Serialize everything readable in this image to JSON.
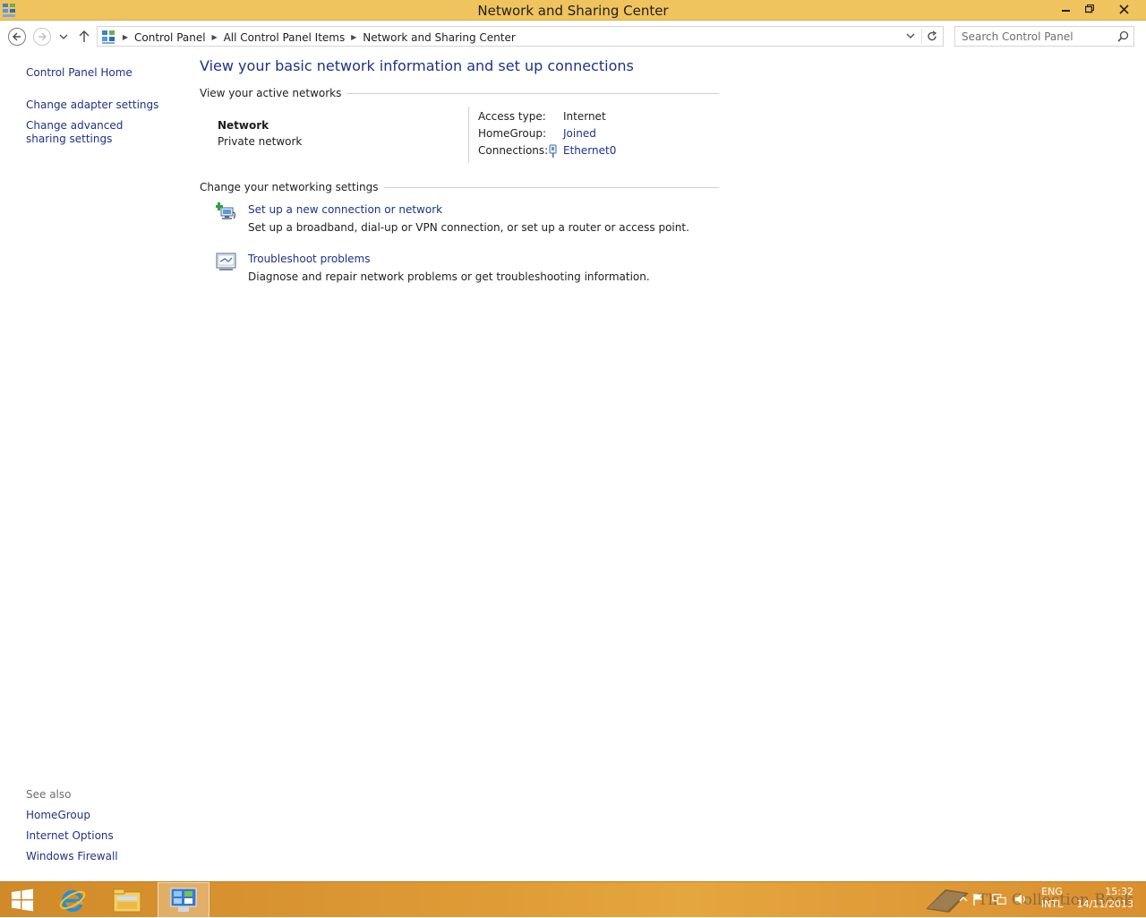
{
  "window": {
    "title": "Network and Sharing Center",
    "accent_color": "#efc35e"
  },
  "address_bar": {
    "breadcrumbs": [
      "Control Panel",
      "All Control Panel Items",
      "Network and Sharing Center"
    ]
  },
  "search": {
    "placeholder": "Search Control Panel"
  },
  "left_pane": {
    "control_panel_home": "Control Panel Home",
    "tasks": [
      "Change adapter settings",
      "Change advanced sharing settings"
    ],
    "see_also_title": "See also",
    "see_also": [
      "HomeGroup",
      "Internet Options",
      "Windows Firewall"
    ]
  },
  "main": {
    "title": "View your basic network information and set up connections",
    "active_networks_header": "View your active networks",
    "network": {
      "name": "Network",
      "category": "Private network",
      "properties": [
        {
          "label": "Access type:",
          "value": "Internet"
        },
        {
          "label": "HomeGroup:",
          "value": "Joined"
        },
        {
          "label": "Connections:",
          "value": "Ethernet0"
        }
      ]
    },
    "change_settings_header": "Change your networking settings",
    "tasks": [
      {
        "title": "Set up a new connection or network",
        "description": "Set up a broadband, dial-up or VPN connection, or set up a router or access point.",
        "icon": "new-connection-icon"
      },
      {
        "title": "Troubleshoot problems",
        "description": "Diagnose and repair network problems or get troubleshooting information.",
        "icon": "troubleshoot-icon"
      }
    ]
  },
  "colors": {
    "link": "#1e3287",
    "taskbar": "#dd9a35"
  },
  "taskbar": {
    "items": [
      "start-icon",
      "internet-explorer-icon",
      "file-explorer-icon",
      "control-panel-icon"
    ]
  },
  "tray": {
    "language": "ENG",
    "layout": "INTL",
    "time": "15:32",
    "date": "14/11/2013"
  },
  "watermark": {
    "text": "The Collection Book"
  }
}
